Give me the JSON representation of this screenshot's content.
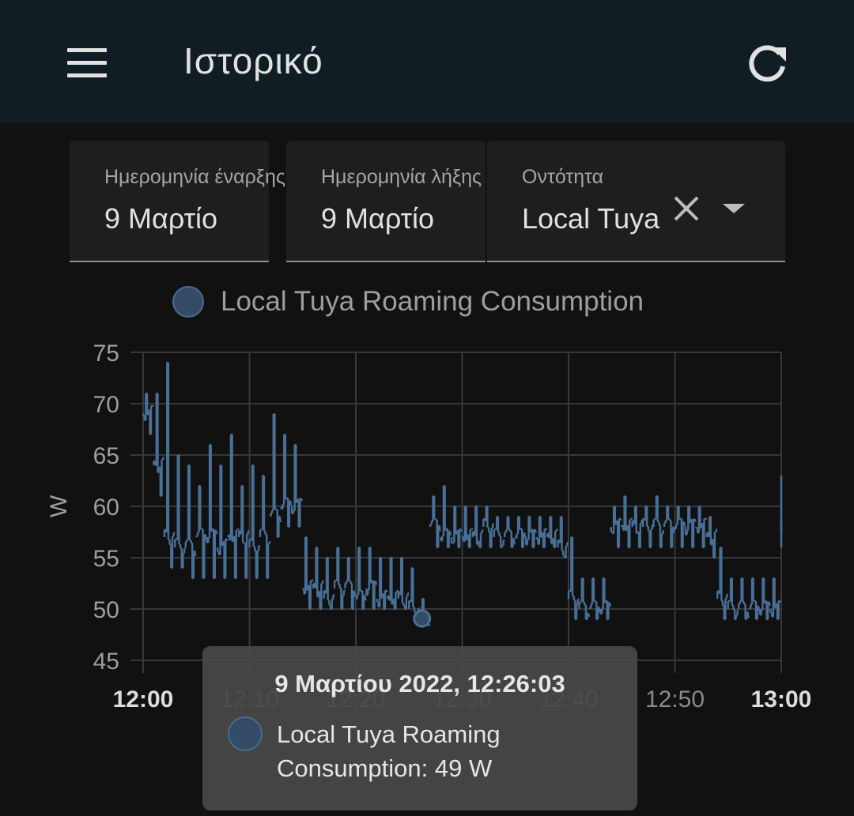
{
  "header": {
    "title": "Ιστορικό",
    "menu_icon": "menu-icon",
    "refresh_icon": "refresh-icon"
  },
  "filters": {
    "start_date": {
      "label": "Ημερομηνία έναρξης",
      "value": "9 Μαρτίο"
    },
    "end_date": {
      "label": "Ημερομηνία λήξης",
      "value": "9 Μαρτίο"
    },
    "entity": {
      "label": "Οντότητα",
      "value": "Local Tuya Roaming Consumption"
    }
  },
  "legend": {
    "label": "Local Tuya Roaming Consumption"
  },
  "colors": {
    "background": "#111111",
    "appbar": "#101e24",
    "series": "#4a6f96",
    "series_fill": "#334b66",
    "grid": "#383838"
  },
  "chart_data": {
    "type": "line",
    "ylabel": "W",
    "ylim": [
      45,
      75
    ],
    "yticks": [
      "45",
      "50",
      "55",
      "60",
      "65",
      "70",
      "75"
    ],
    "xlim": [
      "12:00",
      "13:00"
    ],
    "xticks": [
      "12:00",
      "12:10",
      "12:20",
      "12:30",
      "12:40",
      "12:50",
      "13:00"
    ],
    "xticks_bold": [
      "12:00",
      "13:00"
    ],
    "grid": true,
    "series": [
      {
        "name": "Local Tuya Roaming Consumption",
        "x": [
          "12:00",
          "12:01",
          "12:02",
          "12:03",
          "12:04",
          "12:05",
          "12:06",
          "12:07",
          "12:08",
          "12:09",
          "12:10",
          "12:11",
          "12:12",
          "12:13",
          "12:14",
          "12:15",
          "12:16",
          "12:17",
          "12:18",
          "12:19",
          "12:20",
          "12:21",
          "12:22",
          "12:23",
          "12:24",
          "12:25",
          "12:26",
          "12:27",
          "12:28",
          "12:29",
          "12:30",
          "12:31",
          "12:32",
          "12:33",
          "12:34",
          "12:35",
          "12:36",
          "12:37",
          "12:38",
          "12:39",
          "12:40",
          "12:41",
          "12:42",
          "12:43",
          "12:44",
          "12:45",
          "12:46",
          "12:47",
          "12:48",
          "12:49",
          "12:50",
          "12:51",
          "12:52",
          "12:53",
          "12:54",
          "12:55",
          "12:56",
          "12:57",
          "12:58",
          "12:59",
          "13:00"
        ],
        "values": [
          69,
          64,
          57,
          56,
          56,
          57,
          57,
          56,
          57,
          57,
          56,
          57,
          59,
          60,
          60,
          52,
          52,
          51,
          52,
          52,
          51,
          52,
          51,
          51,
          51,
          50,
          49,
          58,
          57,
          57,
          57,
          57,
          58,
          57,
          57,
          57,
          57,
          57,
          57,
          56,
          51,
          50,
          50,
          50,
          58,
          58,
          58,
          58,
          58,
          58,
          58,
          58,
          58,
          57,
          51,
          50,
          50,
          50,
          50,
          50,
          58
        ],
        "min": [
          67,
          61,
          54,
          54,
          53,
          53,
          53,
          53,
          53,
          53,
          53,
          53,
          57,
          58,
          58,
          50,
          50,
          50,
          50,
          50,
          50,
          50,
          50,
          50,
          50,
          49,
          49,
          56,
          56,
          56,
          56,
          56,
          56,
          56,
          56,
          56,
          56,
          56,
          56,
          55,
          49,
          49,
          49,
          49,
          56,
          56,
          56,
          56,
          56,
          56,
          56,
          56,
          56,
          55,
          49,
          49,
          49,
          49,
          49,
          49,
          56
        ],
        "max": [
          71,
          71,
          74,
          65,
          64,
          62,
          66,
          64,
          67,
          62,
          64,
          63,
          69,
          67,
          66,
          57,
          56,
          55,
          56,
          55,
          56,
          56,
          55,
          55,
          55,
          54,
          51,
          61,
          62,
          60,
          60,
          60,
          60,
          59,
          59,
          59,
          59,
          59,
          59,
          59,
          57,
          53,
          53,
          53,
          60,
          61,
          60,
          60,
          61,
          60,
          60,
          60,
          60,
          59,
          56,
          53,
          53,
          53,
          53,
          53,
          63
        ]
      }
    ]
  },
  "tooltip": {
    "title": "9 Μαρτίου 2022, 12:26:03",
    "text": "Local Tuya Roaming Consumption: 49 W",
    "hover_x": "12:26",
    "hover_value": 49
  }
}
